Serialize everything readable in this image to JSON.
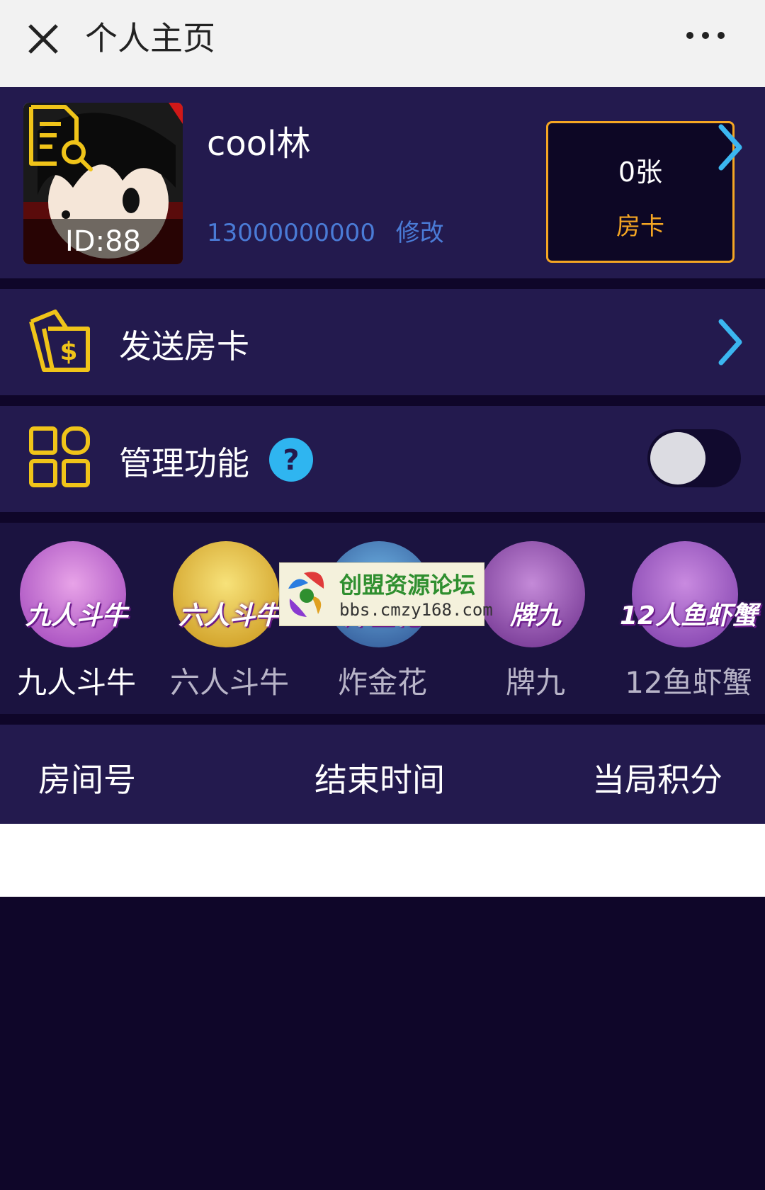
{
  "navbar": {
    "title": "个人主页",
    "close_icon": "close-icon",
    "more_icon": "more-icon"
  },
  "profile": {
    "avatar_id": "ID:88",
    "username": "cool林",
    "phone": "13000000000",
    "edit_label": "修改",
    "card_count": "0张",
    "card_label": "房卡"
  },
  "send_card": {
    "label": "发送房卡",
    "icon": "card-dollar-icon"
  },
  "manage": {
    "label": "管理功能",
    "icon": "grid-icon",
    "toggle_on": false
  },
  "games": [
    {
      "name": "九人斗牛",
      "badge": "九人斗牛",
      "color": "#ffffff"
    },
    {
      "name": "六人斗牛",
      "badge": "六人斗牛",
      "color": "#b8b4c8"
    },
    {
      "name": "炸金花",
      "badge": "炸金花",
      "color": "#b8b4c8"
    },
    {
      "name": "牌九",
      "badge": "牌九",
      "color": "#b8b4c8"
    },
    {
      "name": "12鱼虾蟹",
      "badge": "12人鱼虾蟹",
      "color": "#b8b4c8"
    }
  ],
  "watermark": {
    "title": "创盟资源论坛",
    "url": "bbs.cmzy168.com"
  },
  "table": {
    "columns": [
      "房间号",
      "结束时间",
      "当局积分"
    ]
  },
  "colors": {
    "accent_gold": "#f5a623",
    "link_blue": "#4a7bd6",
    "arrow_cyan": "#3bb6f0",
    "panel": "#231a4e",
    "background": "#0f0629"
  }
}
